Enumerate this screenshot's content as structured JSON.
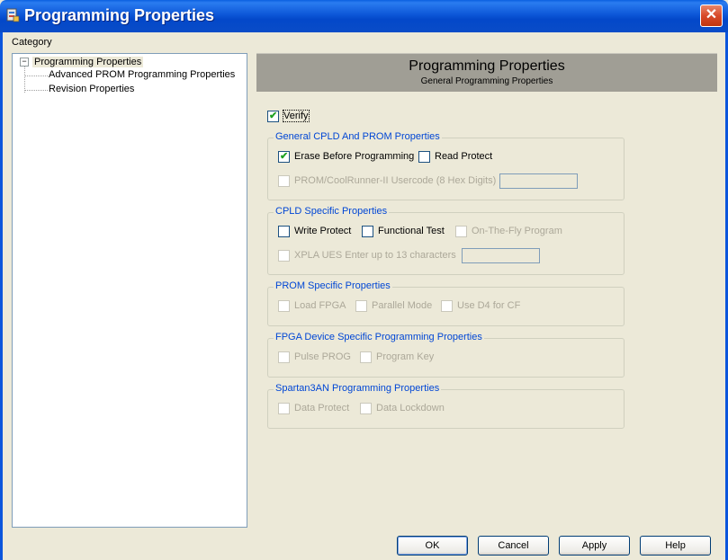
{
  "window": {
    "title": "Programming Properties",
    "close_glyph": "✕"
  },
  "category": {
    "label": "Category",
    "tree": {
      "root": "Programming Properties",
      "expander": "−",
      "children": [
        "Advanced PROM Programming Properties",
        "Revision Properties"
      ]
    }
  },
  "banner": {
    "title": "Programming Properties",
    "subtitle": "General Programming Properties"
  },
  "verify": {
    "label": "Verify",
    "checked": true
  },
  "groups": {
    "general": {
      "title": "General CPLD And PROM Properties",
      "erase": {
        "label": "Erase Before Programming",
        "checked": true
      },
      "read_protect": {
        "label": "Read Protect",
        "checked": false
      },
      "usercode": {
        "label": "PROM/CoolRunner-II Usercode (8 Hex Digits)",
        "value": ""
      }
    },
    "cpld": {
      "title": "CPLD Specific Properties",
      "write_protect": {
        "label": "Write Protect",
        "checked": false
      },
      "functional_test": {
        "label": "Functional Test",
        "checked": false
      },
      "on_the_fly": {
        "label": "On-The-Fly Program",
        "checked": false
      },
      "xpla": {
        "label": "XPLA UES Enter up to 13 characters",
        "value": ""
      }
    },
    "prom": {
      "title": "PROM Specific Properties",
      "load_fpga": {
        "label": "Load FPGA"
      },
      "parallel_mode": {
        "label": "Parallel Mode"
      },
      "use_d4": {
        "label": "Use D4 for CF"
      }
    },
    "fpga": {
      "title": "FPGA Device Specific Programming Properties",
      "pulse_prog": {
        "label": "Pulse PROG"
      },
      "program_key": {
        "label": "Program Key"
      }
    },
    "spartan": {
      "title": "Spartan3AN Programming Properties",
      "data_protect": {
        "label": "Data Protect"
      },
      "data_lockdown": {
        "label": "Data Lockdown"
      }
    }
  },
  "buttons": {
    "ok": "OK",
    "cancel": "Cancel",
    "apply": "Apply",
    "help": "Help"
  },
  "check_glyph": "✔",
  "colors": {
    "title_bar": "#0a4cc8",
    "group_title": "#0046d5",
    "check": "#21a121",
    "banner": "#a09e95"
  }
}
